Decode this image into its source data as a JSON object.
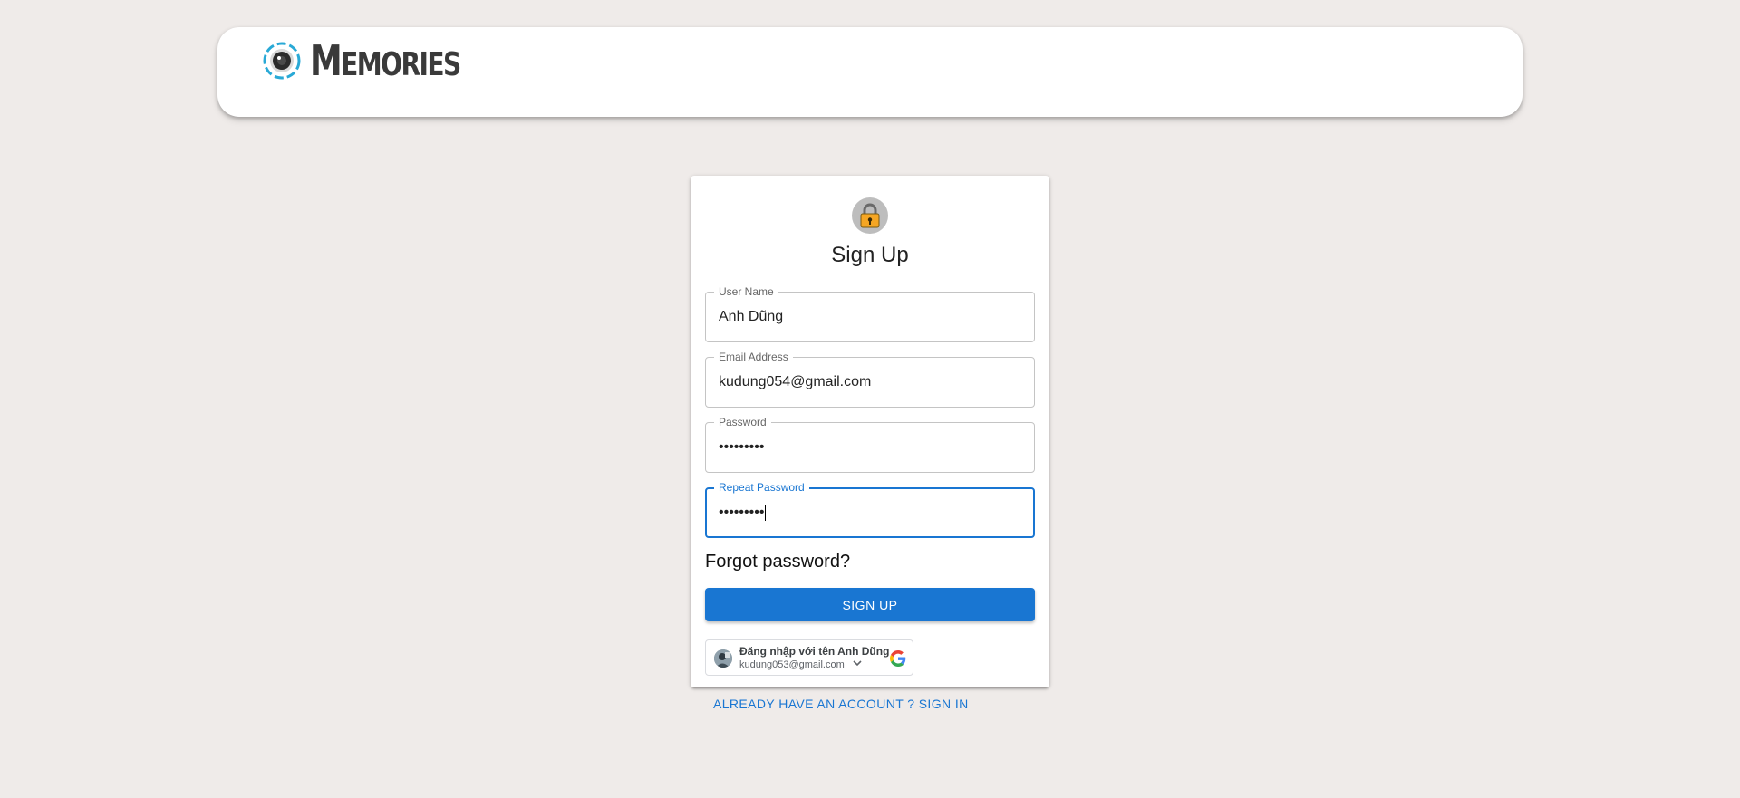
{
  "brand": {
    "title_first": "M",
    "title_rest": "EMORIES",
    "logo_icon": "camera-lens-icon"
  },
  "form": {
    "icon": "lock-icon",
    "heading": "Sign Up",
    "fields": [
      {
        "label": "User Name",
        "value": "Anh Dũng"
      },
      {
        "label": "Email Address",
        "value": "kudung054@gmail.com"
      },
      {
        "label": "Password",
        "value": "•••••••••"
      },
      {
        "label": "Repeat Password",
        "value": "•••••••••"
      }
    ],
    "forgot_password": "Forgot password?",
    "submit_label": "SIGN UP",
    "google": {
      "name_line": "Đăng nhập với tên Anh Dũng",
      "email": "kudung053@gmail.com",
      "icon": "google-g-icon"
    },
    "signin_link": "ALREADY HAVE AN ACCOUNT ? SIGN IN"
  },
  "colors": {
    "background": "#efebe9",
    "primary": "#1976d2",
    "brand_text": "#3a3a3a"
  }
}
